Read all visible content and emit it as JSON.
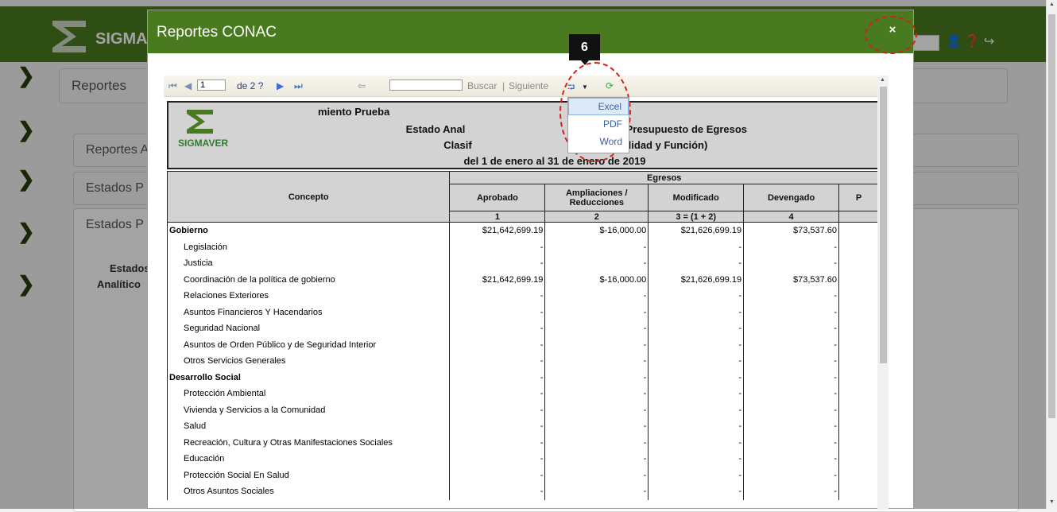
{
  "app": {
    "brand": "SIGMA",
    "left_nav_icons": [
      "chevron-right-icon",
      "chevron-right-icon",
      "chevron-right-icon",
      "chevron-right-icon",
      "chevron-right-icon"
    ]
  },
  "background": {
    "panels": [
      "Reportes",
      "Reportes A",
      "Estados P",
      "Estados P"
    ],
    "side_text": [
      "Estados",
      "Analítico"
    ]
  },
  "modal": {
    "title": "Reportes CONAC",
    "close_icon": "×",
    "callout_number": "6"
  },
  "toolbar": {
    "page_value": "1",
    "page_of": "de 2 ?",
    "search_placeholder": "",
    "search_label": "Buscar",
    "separator": "|",
    "next_label": "Siguiente",
    "export_menu": [
      "Excel",
      "PDF",
      "Word"
    ],
    "export_active": "Excel"
  },
  "report": {
    "brand": "SIGMAVER",
    "lines": [
      "Ayuntamiento Prueba",
      "Estado Analítico del Ejercicio del Presupuesto de Egresos",
      "Clasificación Funcional (Finalidad y Función)",
      "del 1 de enero al 31 de enero de 2019"
    ],
    "visible_lines": [
      "miento Prueba",
      "Estado Anal",
      "cicio del Presupuesto de Egresos",
      "Clasif",
      "ional (Finalidad y Función)",
      "del 1 de enero al 31 de enero de 2019"
    ],
    "header": {
      "concepto": "Concepto",
      "egresos": "Egresos",
      "cols": [
        "Aprobado",
        "Ampliaciones / Reducciones",
        "Modificado",
        "Devengado",
        "P"
      ],
      "nums": [
        "1",
        "2",
        "3 = (1 + 2)",
        "4",
        ""
      ]
    },
    "rows": [
      {
        "label": "Gobierno",
        "group": true,
        "v": [
          "$21,642,699.19",
          "$-16,000.00",
          "$21,626,699.19",
          "$73,537.60"
        ]
      },
      {
        "label": "Legislación",
        "group": false,
        "v": [
          "-",
          "-",
          "-",
          "-"
        ]
      },
      {
        "label": "Justicia",
        "group": false,
        "v": [
          "-",
          "-",
          "-",
          "-"
        ]
      },
      {
        "label": "Coordinación de la política de gobierno",
        "group": false,
        "v": [
          "$21,642,699.19",
          "$-16,000.00",
          "$21,626,699.19",
          "$73,537.60"
        ]
      },
      {
        "label": "Relaciones Exteriores",
        "group": false,
        "v": [
          "-",
          "-",
          "-",
          "-"
        ]
      },
      {
        "label": "Asuntos Financieros Y Hacendarios",
        "group": false,
        "v": [
          "-",
          "-",
          "-",
          "-"
        ]
      },
      {
        "label": "Seguridad Nacional",
        "group": false,
        "v": [
          "-",
          "-",
          "-",
          "-"
        ]
      },
      {
        "label": "Asuntos de Orden Público y de Seguridad Interior",
        "group": false,
        "v": [
          "-",
          "-",
          "-",
          "-"
        ]
      },
      {
        "label": "Otros Servicios Generales",
        "group": false,
        "v": [
          "-",
          "-",
          "-",
          "-"
        ]
      },
      {
        "label": "Desarrollo Social",
        "group": true,
        "v": [
          "-",
          "-",
          "-",
          "-"
        ]
      },
      {
        "label": "Protección Ambiental",
        "group": false,
        "v": [
          "-",
          "-",
          "-",
          "-"
        ]
      },
      {
        "label": "Vivienda y Servicios a la Comunidad",
        "group": false,
        "v": [
          "-",
          "-",
          "-",
          "-"
        ]
      },
      {
        "label": "Salud",
        "group": false,
        "v": [
          "-",
          "-",
          "-",
          "-"
        ]
      },
      {
        "label": "Recreación, Cultura y Otras Manifestaciones Sociales",
        "group": false,
        "v": [
          "-",
          "-",
          "-",
          "-"
        ]
      },
      {
        "label": "Educación",
        "group": false,
        "v": [
          "-",
          "-",
          "-",
          "-"
        ]
      },
      {
        "label": "Protección Social En Salud",
        "group": false,
        "v": [
          "-",
          "-",
          "-",
          "-"
        ]
      },
      {
        "label": "Otros Asuntos Sociales",
        "group": false,
        "v": [
          "-",
          "-",
          "-",
          "-"
        ]
      }
    ]
  }
}
